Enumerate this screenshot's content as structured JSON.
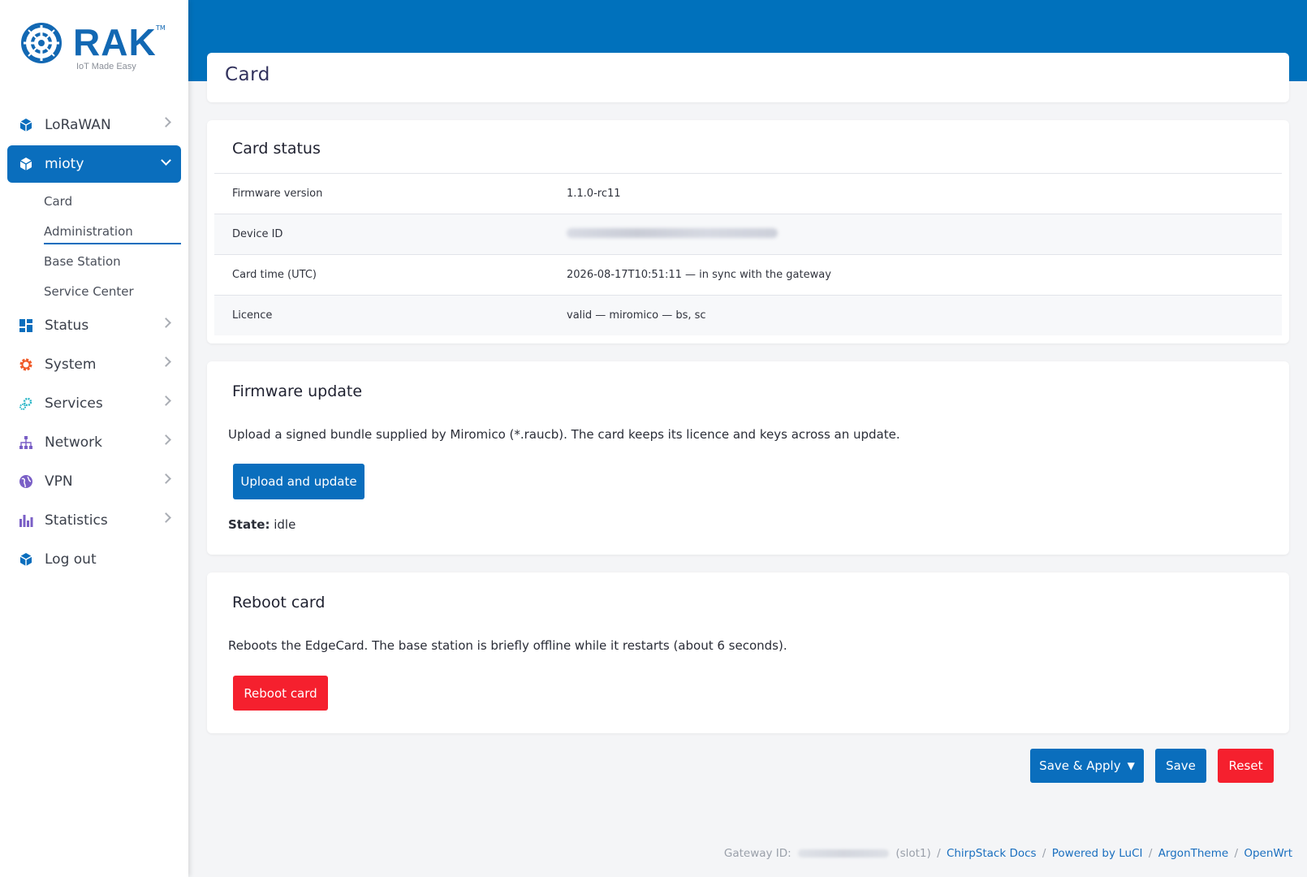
{
  "brand": {
    "name": "RAK",
    "tm": "TM",
    "tagline": "IoT Made Easy",
    "color": "#1268b3"
  },
  "sidebar": {
    "items": [
      {
        "label": "LoRaWAN",
        "icon": "cube-icon",
        "color": "#0a6ebd"
      },
      {
        "label": "mioty",
        "icon": "cube-icon",
        "active": true
      },
      {
        "label": "Status",
        "icon": "dashboard-icon",
        "color": "#0a6ebd"
      },
      {
        "label": "System",
        "icon": "gear-icon",
        "color": "#f05a28"
      },
      {
        "label": "Services",
        "icon": "gears-icon",
        "color": "#26b5c6"
      },
      {
        "label": "Network",
        "icon": "network-icon",
        "color": "#7a5fc6"
      },
      {
        "label": "VPN",
        "icon": "globe-icon",
        "color": "#7a5fc6"
      },
      {
        "label": "Statistics",
        "icon": "bar-chart-icon",
        "color": "#7a5fc6"
      },
      {
        "label": "Log out",
        "icon": "cube-icon",
        "color": "#0a6ebd"
      }
    ],
    "mioty_sub": [
      "Card",
      "Administration",
      "Base Station",
      "Service Center"
    ],
    "accent": "#0a6ebd"
  },
  "page": {
    "title": "Card"
  },
  "card_status": {
    "title": "Card status",
    "rows": [
      {
        "key": "Firmware version",
        "value": "1.1.0-rc11"
      },
      {
        "key": "Device ID",
        "value": ""
      },
      {
        "key": "Card time (UTC)",
        "value": "2026-08-17T10:51:11 — in sync with the gateway"
      },
      {
        "key": "Licence",
        "value": "valid — miromico — bs, sc"
      }
    ]
  },
  "firmware": {
    "title": "Firmware update",
    "description": "Upload a signed bundle supplied by Miromico (*.raucb). The card keeps its licence and keys across an update.",
    "button": "Upload and update",
    "state_label": "State:",
    "state_value": "idle"
  },
  "reboot": {
    "title": "Reboot card",
    "description": "Reboots the EdgeCard. The base station is briefly offline while it restarts (about 6 seconds).",
    "button": "Reboot card"
  },
  "actions": {
    "save_apply": "Save & Apply",
    "save_apply_caret": "▼",
    "save": "Save",
    "reset": "Reset"
  },
  "footer": {
    "gateway_label": "Gateway ID:",
    "slot": "(slot1)",
    "links": [
      "ChirpStack Docs",
      "Powered by LuCI",
      "ArgonTheme",
      "OpenWrt"
    ],
    "sep": "/"
  },
  "colors": {
    "header": "#0071bc",
    "primary": "#0a6ebd",
    "danger": "#f5202e"
  }
}
